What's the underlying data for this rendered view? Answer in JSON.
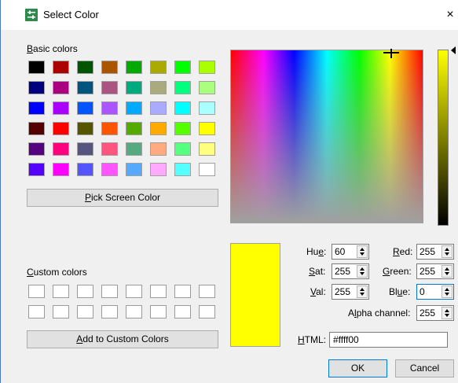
{
  "window": {
    "title": "Select Color",
    "close_glyph": "×"
  },
  "basic_colors": {
    "label_prefix": "B",
    "label_rest": "asic colors",
    "swatches": [
      "#000000",
      "#aa0000",
      "#005500",
      "#aa5500",
      "#00aa00",
      "#aaaa00",
      "#00ff00",
      "#aaff00",
      "#00007f",
      "#aa007f",
      "#00557f",
      "#aa557f",
      "#00aa7f",
      "#aaaa7f",
      "#00ff7f",
      "#aaff7f",
      "#0000ff",
      "#aa00ff",
      "#0055ff",
      "#aa55ff",
      "#00aaff",
      "#aaaaff",
      "#00ffff",
      "#aaffff",
      "#550000",
      "#ff0000",
      "#555500",
      "#ff5500",
      "#55aa00",
      "#ffaa00",
      "#55ff00",
      "#ffff00",
      "#55007f",
      "#ff007f",
      "#55557f",
      "#ff557f",
      "#55aa7f",
      "#ffaa7f",
      "#55ff7f",
      "#ffff7f",
      "#5500ff",
      "#ff00ff",
      "#5555ff",
      "#ff55ff",
      "#55aaff",
      "#ffaaff",
      "#55ffff",
      "#ffffff"
    ]
  },
  "pick_screen": {
    "label_prefix": "P",
    "label_rest": "ick Screen Color"
  },
  "custom_colors": {
    "label_prefix": "C",
    "label_rest": "ustom colors"
  },
  "add_custom": {
    "label_prefix": "A",
    "label_rest": "dd to Custom Colors"
  },
  "current_color": "#ffff00",
  "fields": {
    "hue": {
      "label_prefix": "Hu",
      "label_u": "e",
      "label_rest": ":",
      "value": "60"
    },
    "sat": {
      "label_prefix": "",
      "label_u": "S",
      "label_rest": "at:",
      "value": "255"
    },
    "val": {
      "label_prefix": "",
      "label_u": "V",
      "label_rest": "al:",
      "value": "255"
    },
    "red": {
      "label_prefix": "",
      "label_u": "R",
      "label_rest": "ed:",
      "value": "255"
    },
    "green": {
      "label_prefix": "",
      "label_u": "G",
      "label_rest": "reen:",
      "value": "255"
    },
    "blue": {
      "label_prefix": "Bl",
      "label_u": "u",
      "label_rest": "e:",
      "value": "0"
    },
    "alpha": {
      "label_prefix": "A",
      "label_u": "l",
      "label_rest": "pha channel:",
      "value": "255"
    }
  },
  "html_field": {
    "label_u": "H",
    "label_rest": "TML:",
    "value": "#ffff00"
  },
  "ok_label": "OK",
  "cancel_label": "Cancel"
}
